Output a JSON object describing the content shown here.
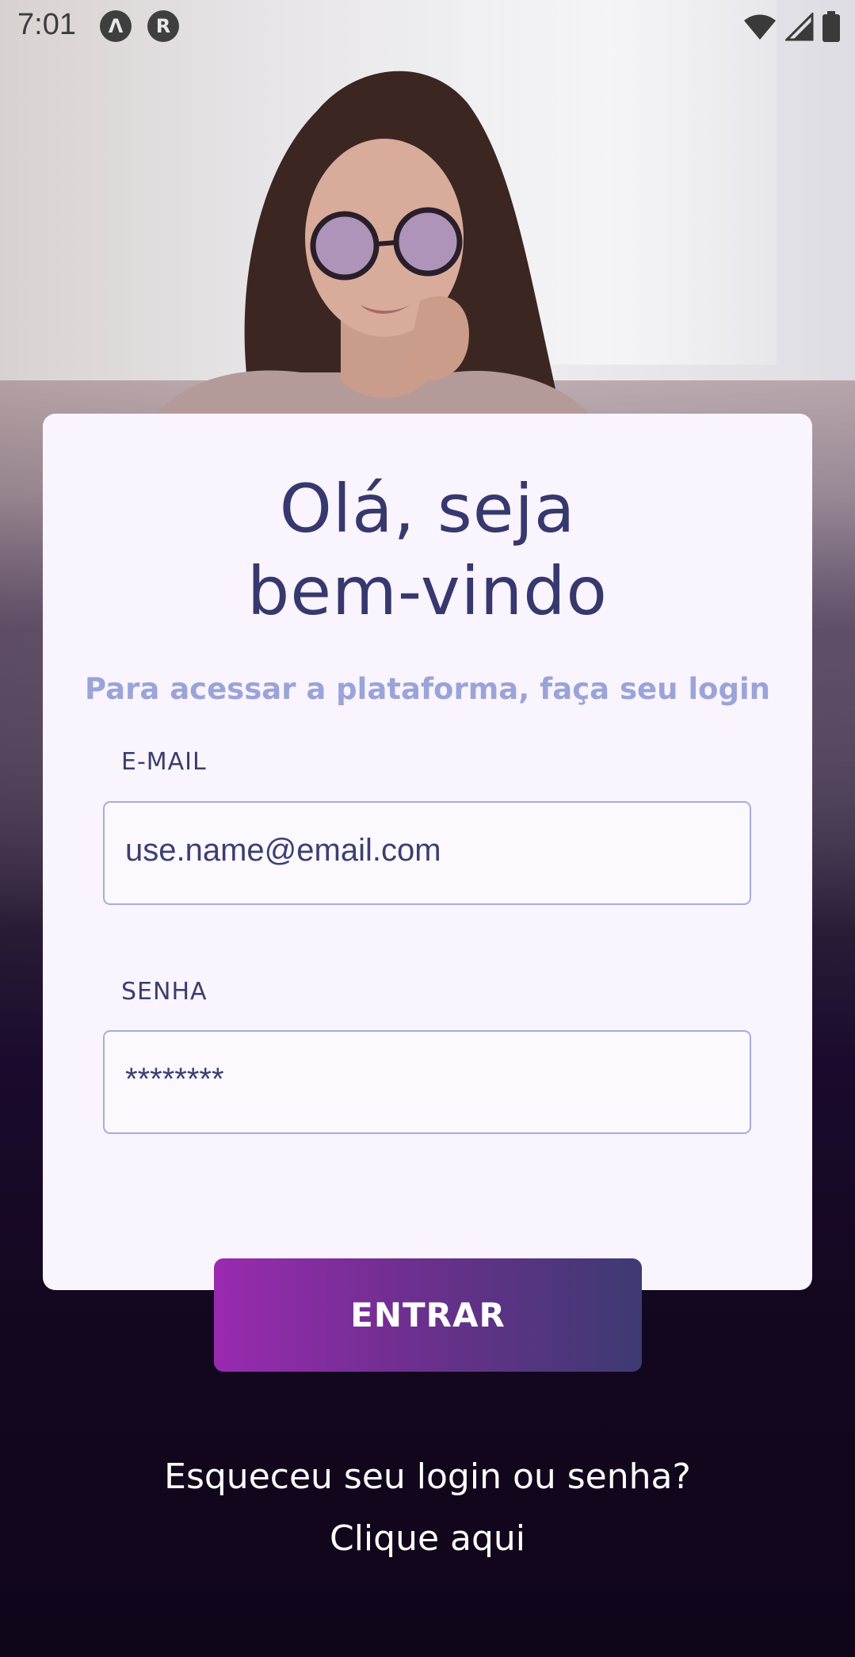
{
  "status_bar": {
    "time": "7:01",
    "left_icons": [
      "app-a-icon",
      "app-r-icon"
    ],
    "right_icons": [
      "wifi-icon",
      "signal-icon",
      "battery-icon"
    ],
    "app_icon_1_glyph": "Λ",
    "app_icon_2_glyph": "R"
  },
  "login": {
    "title_line1": "Olá, seja",
    "title_line2": "bem-vindo",
    "subtitle": "Para acessar a plataforma, faça seu login",
    "email_label": "E-MAIL",
    "email_value": "use.name@email.com",
    "password_label": "SENHA",
    "password_value": "********",
    "submit_label": "ENTRAR"
  },
  "footer": {
    "forgot_line1": "Esqueceu seu login ou senha?",
    "forgot_line2": "Clique aqui"
  },
  "colors": {
    "card_bg": "#f9f4fd",
    "title": "#36386e",
    "subtitle": "#9ba4d8",
    "button_start": "#9a2ab0",
    "button_end": "#3d3a72",
    "background_dark": "#160a26"
  }
}
